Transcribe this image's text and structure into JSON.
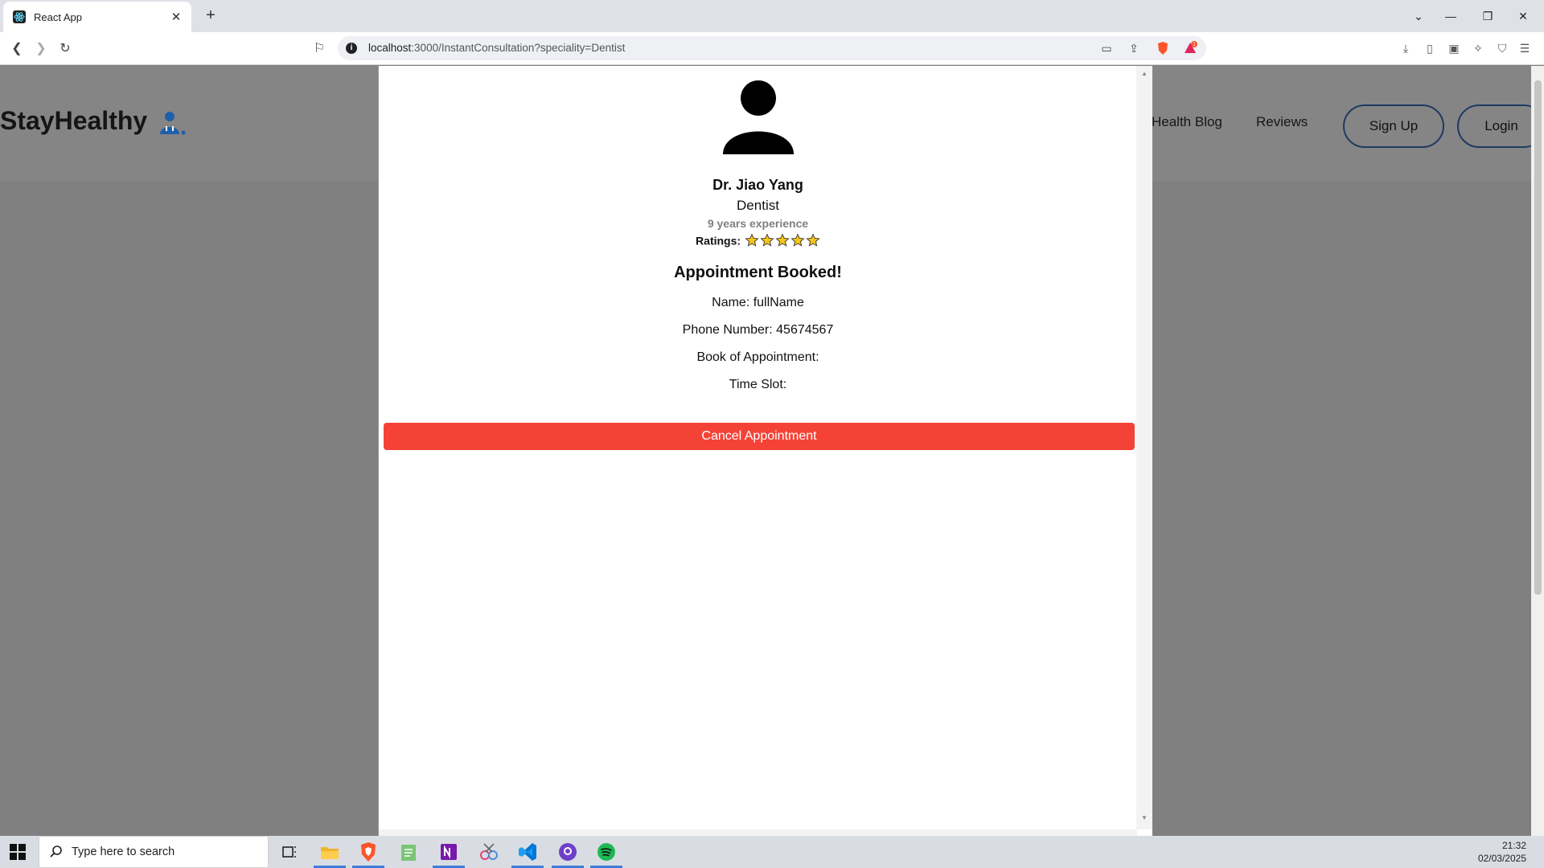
{
  "browser": {
    "tab_title": "React App",
    "url_host": "localhost",
    "url_path": ":3000/InstantConsultation?speciality=Dentist",
    "badge_count": "1"
  },
  "site": {
    "brand": "StayHealthy",
    "nav": {
      "health_blog": "Health Blog",
      "reviews": "Reviews",
      "sign_up": "Sign Up",
      "login": "Login"
    }
  },
  "doctor": {
    "name": "Dr. Jiao Yang",
    "speciality": "Dentist",
    "experience": "9 years experience",
    "ratings_label": "Ratings:",
    "stars": 5
  },
  "booking": {
    "title": "Appointment Booked!",
    "name_line": "Name: fullName",
    "phone_line": "Phone Number: 45674567",
    "date_line": "Book of Appointment:",
    "time_line": "Time Slot:",
    "cancel_label": "Cancel Appointment"
  },
  "taskbar": {
    "search_placeholder": "Type here to search",
    "time": "21:32",
    "date": "02/03/2025"
  },
  "colors": {
    "cancel": "#f44336",
    "brand_icon": "#1e5fa8",
    "star_fill": "#f5c518"
  }
}
